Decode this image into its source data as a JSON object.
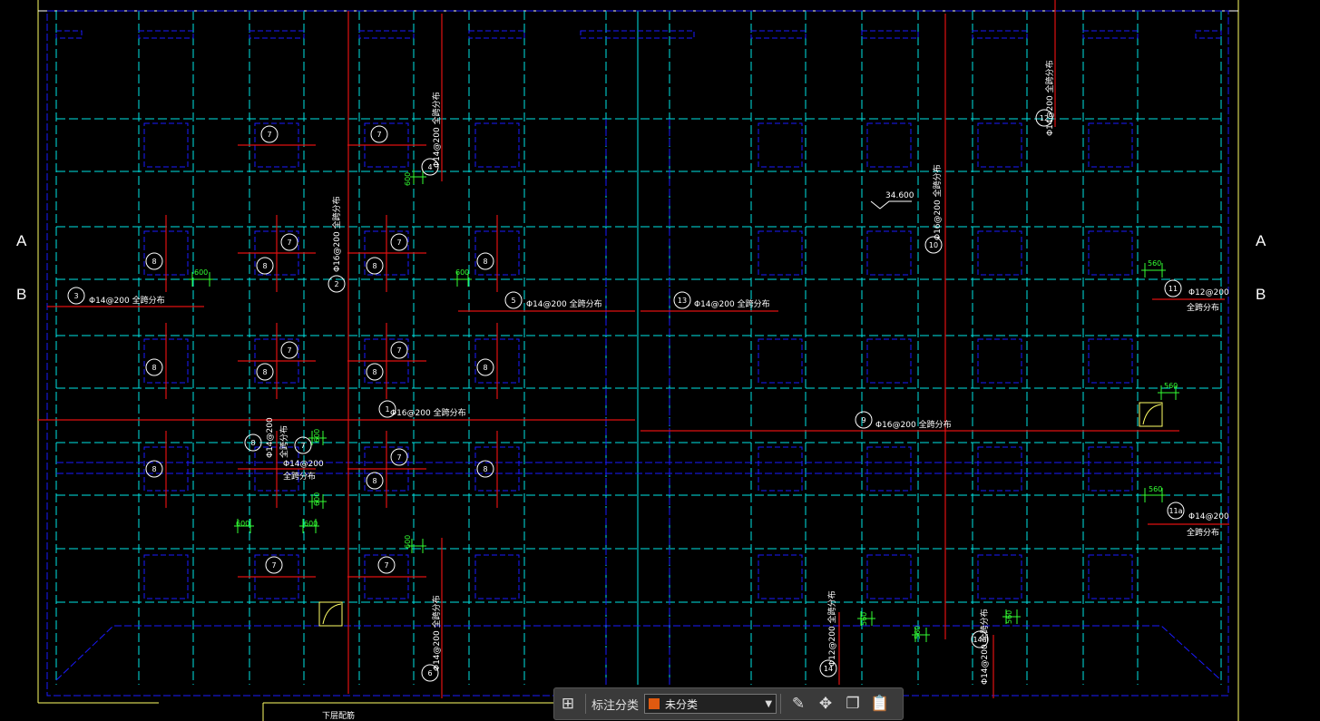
{
  "drawing": {
    "section_labels": {
      "a_left": "A",
      "a_right": "A",
      "b_left": "B",
      "b_right": "B"
    },
    "rebar_notes": {
      "n1": "Φ16@200 全跨分布",
      "n2": "Φ16@200 全跨分布",
      "n3": "Φ14@200 全跨分布",
      "n4": "Φ14@200 全跨分布",
      "n5": "Φ14@200 全跨分布",
      "n6": "Φ14@200 全跨分布",
      "n9": "Φ16@200 全跨分布",
      "n10": "Φ16@200 全跨分布",
      "n11_a": "Φ12@200",
      "n11_b": "全跨分布",
      "n11a_a": "Φ14@200",
      "n11a_b": "全跨分布",
      "n12": "Φ14@200 全跨分布",
      "n13": "Φ14@200 全跨分布",
      "n14": "Φ12@200 全跨分布",
      "n14a": "Φ14@200 全跨分布",
      "n_small_a": "Φ14@200",
      "n_small_b": "全跨分布",
      "n_small_c": "Φ14@200",
      "n_small_d": "全跨分布"
    },
    "markers": {
      "m1": "1",
      "m2": "2",
      "m3": "3",
      "m4": "4",
      "m5": "5",
      "m6": "6",
      "m7": "7",
      "m8": "8",
      "m9": "9",
      "m10": "10",
      "m11": "11",
      "m11a": "11a",
      "m12": "12",
      "m13": "13",
      "m14": "14",
      "m14a": "14a"
    },
    "dimensions": {
      "d600": "600",
      "d560": "560"
    },
    "elevation": "34.600",
    "bottom_text": "下层配筋"
  },
  "toolbar": {
    "category_label": "标注分类",
    "selected_category": "未分类",
    "swatch_color": "#e05a10",
    "icons": [
      "grid-icon",
      "edit-icon",
      "move-icon",
      "copy-icon",
      "paste-icon"
    ]
  },
  "colors": {
    "background": "#000000",
    "grid_cyan": "#00e5e5",
    "wall_blue": "#1a1aff",
    "rebar_red": "#e01010",
    "dim_green": "#33ff33",
    "text_white": "#ffffff",
    "border_yellow": "#ffff66"
  }
}
